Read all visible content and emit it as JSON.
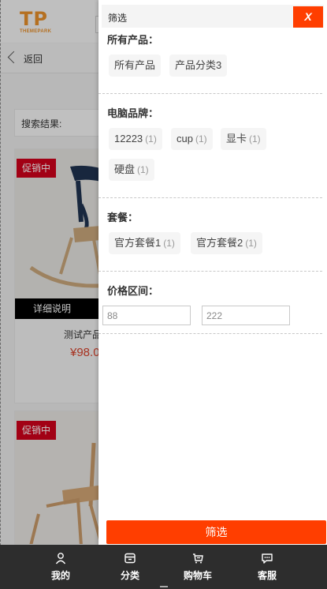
{
  "brand": {
    "logo_text": "TP",
    "logo_subtext": "THEMEPARK",
    "color": "#e8902b"
  },
  "back": {
    "label": "返回"
  },
  "search": {
    "result_label": "搜索结果:"
  },
  "products": [
    {
      "badge": "促销中",
      "detail_label": "详细说明",
      "name": "测试产品",
      "price": "¥98.0"
    },
    {
      "badge": "促销中"
    }
  ],
  "filter": {
    "title": "筛选",
    "close_label": "X",
    "groups": [
      {
        "heading": "所有产品：",
        "options": [
          {
            "label": "所有产品"
          },
          {
            "label": "产品分类3"
          }
        ]
      },
      {
        "heading": "电脑品牌：",
        "options": [
          {
            "label": "12223",
            "count": "(1)"
          },
          {
            "label": "cup",
            "count": "(1)"
          },
          {
            "label": "显卡",
            "count": "(1)"
          },
          {
            "label": "硬盘",
            "count": "(1)"
          }
        ]
      },
      {
        "heading": "套餐：",
        "options": [
          {
            "label": "官方套餐1",
            "count": "(1)"
          },
          {
            "label": "官方套餐2",
            "count": "(1)"
          }
        ]
      }
    ],
    "price": {
      "heading": "价格区间：",
      "min_value": "88",
      "max_value": "222"
    },
    "apply_label": "筛选",
    "accent_color": "#ff3e00"
  },
  "bottom_nav": [
    {
      "label": "我的",
      "icon": "user-icon"
    },
    {
      "label": "分类",
      "icon": "category-icon"
    },
    {
      "label": "购物车",
      "icon": "cart-icon"
    },
    {
      "label": "客服",
      "icon": "chat-icon"
    }
  ]
}
